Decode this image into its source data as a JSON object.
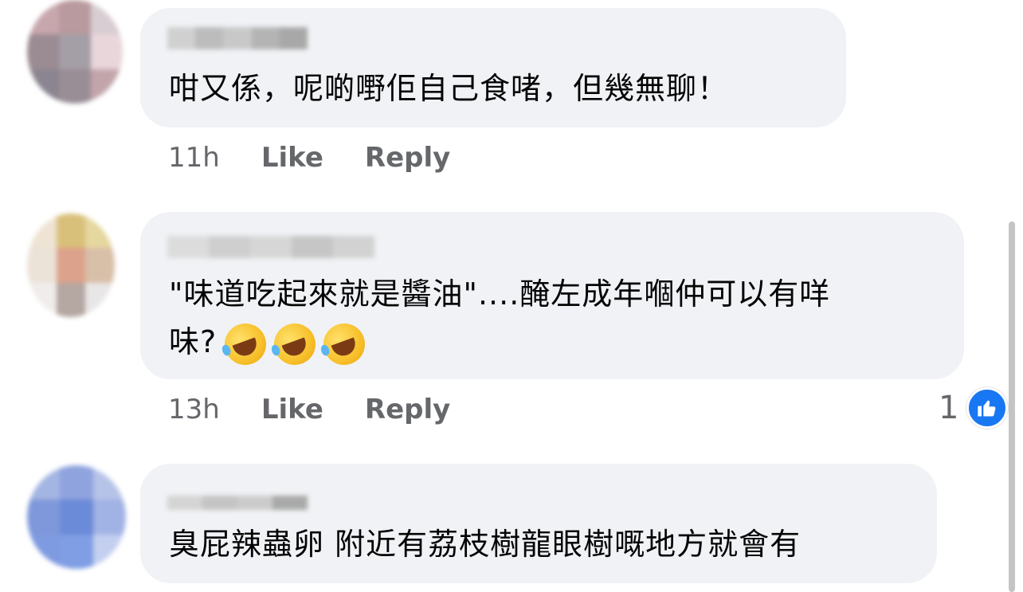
{
  "comments": [
    {
      "text": "咁又係，呢啲嘢佢自己食啫，但幾無聊！",
      "time": "11h",
      "like_label": "Like",
      "reply_label": "Reply"
    },
    {
      "text_line1": "\"味道吃起來就是醬油\"....醃左成年嗰仲可以有咩",
      "text_line2": "味?",
      "emoji_icon": "rolling-on-floor-laughing-emoji",
      "emoji_count": 3,
      "time": "13h",
      "like_label": "Like",
      "reply_label": "Reply",
      "reaction_count": "1",
      "reaction_icon": "thumbs-up-icon"
    },
    {
      "text": "臭屁辣蟲卵 附近有荔枝樹龍眼樹嘅地方就會有"
    }
  ],
  "colors": {
    "bubble": "#f0f2f5",
    "text": "#050505",
    "secondary": "#65676b",
    "like_blue": "#1877f2"
  }
}
